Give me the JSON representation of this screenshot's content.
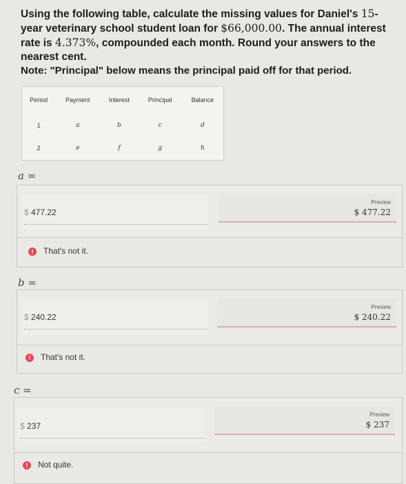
{
  "question": {
    "text_1": "Using the following table, calculate the missing values for Daniel's",
    "years": "15",
    "text_2": "-year veterinary school student loan for",
    "amount": "$66,000.00",
    "text_3": ". The annual interest rate is",
    "rate": "4.373%",
    "text_4": ", compounded each month. Round your answers to the nearest cent.",
    "note": "Note: \"Principal\" below means the principal paid off for that period."
  },
  "table": {
    "headers": [
      "Period",
      "Payment",
      "Interest",
      "Principal",
      "Balance"
    ],
    "rows": [
      [
        "1",
        "a",
        "b",
        "c",
        "d"
      ],
      [
        "2",
        "e",
        "f",
        "g",
        "h"
      ]
    ]
  },
  "answers": [
    {
      "label": "a =",
      "currency": "$",
      "value": "477.22",
      "preview_label": "Preview",
      "preview_value": "$ 477.22",
      "feedback_icon": "!",
      "feedback": "That's not it."
    },
    {
      "label": "b =",
      "currency": "$",
      "value": "240.22",
      "preview_label": "Preview",
      "preview_value": "$ 240.22",
      "feedback_icon": "!",
      "feedback": "That's not it."
    },
    {
      "label": "c =",
      "currency": "$",
      "value": "237",
      "preview_label": "Preview",
      "preview_value": "$ 237",
      "feedback_icon": "!",
      "feedback": "Not quite."
    }
  ],
  "colors": {
    "warning": "#e24a57",
    "preview_underline": "#d8b0a8"
  }
}
